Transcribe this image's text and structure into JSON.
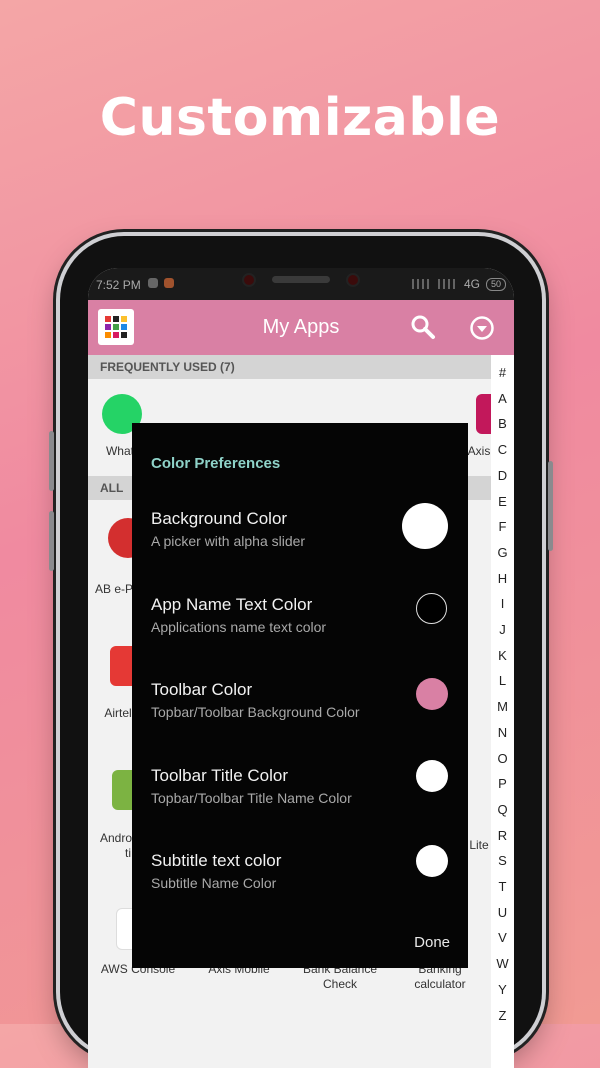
{
  "headline": "Customizable",
  "status_bar": {
    "time": "7:52 PM",
    "network": "4G",
    "battery": "50"
  },
  "toolbar": {
    "title": "My Apps",
    "color": "#d980a4"
  },
  "sections": {
    "frequently_used": "FREQUENTLY USED   (7)",
    "all": "ALL"
  },
  "background_apps": [
    {
      "label": "What"
    },
    {
      "label": "Axis"
    },
    {
      "label": "AB e-P"
    },
    {
      "label": "Airtel"
    },
    {
      "label": "Andro"
    },
    {
      "label": "ti"
    },
    {
      "label": "Lite"
    },
    {
      "label": "AWS Console"
    },
    {
      "label": "Axis Mobile"
    },
    {
      "label": "Bank Balance Check"
    },
    {
      "label": "Banking calculator"
    }
  ],
  "index_letters": [
    "#",
    "A",
    "B",
    "C",
    "D",
    "E",
    "F",
    "G",
    "H",
    "I",
    "J",
    "K",
    "L",
    "M",
    "N",
    "O",
    "P",
    "Q",
    "R",
    "S",
    "T",
    "U",
    "V",
    "W",
    "Y",
    "Z"
  ],
  "dialog": {
    "title": "Color Preferences",
    "items": [
      {
        "title": "Background Color",
        "subtitle": "A picker with alpha slider",
        "color": "#ffffff"
      },
      {
        "title": "App Name Text Color",
        "subtitle": "Applications name text color",
        "color": "#000000"
      },
      {
        "title": "Toolbar Color",
        "subtitle": "Topbar/Toolbar Background Color",
        "color": "#d980a4"
      },
      {
        "title": "Toolbar Title Color",
        "subtitle": "Topbar/Toolbar Title Name Color",
        "color": "#ffffff"
      },
      {
        "title": "Subtitle text color",
        "subtitle": "Subtitle Name Color",
        "color": "#ffffff"
      }
    ],
    "done_label": "Done"
  }
}
